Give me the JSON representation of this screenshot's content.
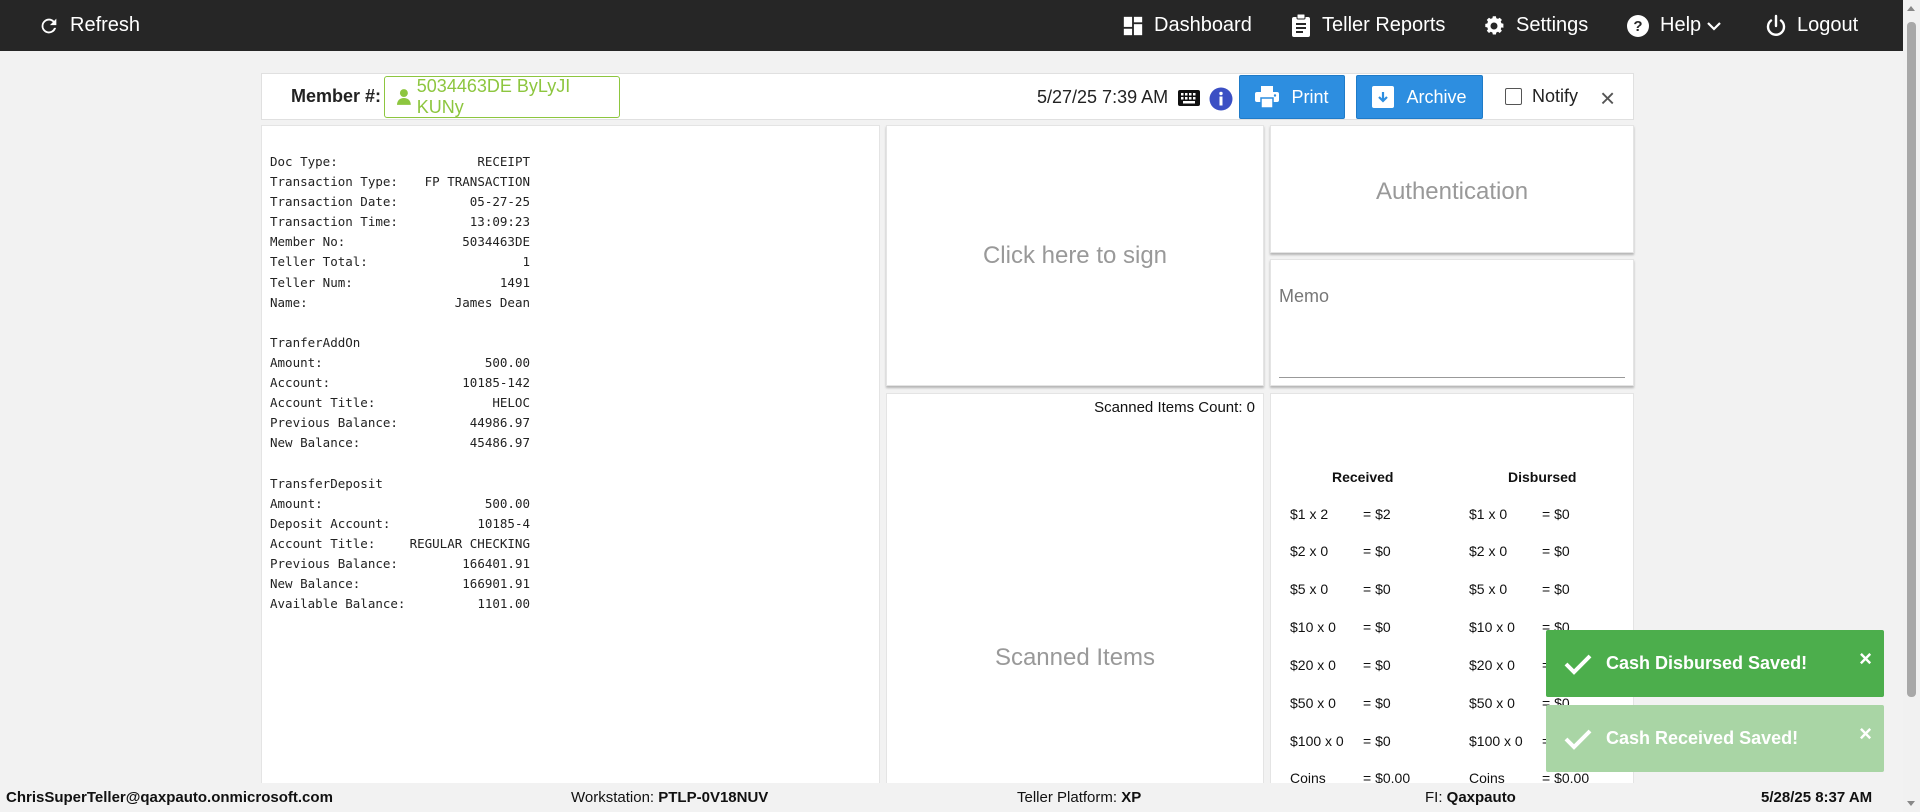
{
  "nav": {
    "refresh": "Refresh",
    "dashboard": "Dashboard",
    "teller_reports": "Teller Reports",
    "settings": "Settings",
    "help": "Help",
    "logout": "Logout"
  },
  "member_bar": {
    "label": "Member #:",
    "member_value": "5034463DE ByLyJI KUNy",
    "datetime": "5/27/25 7:39 AM",
    "print_label": "Print",
    "archive_label": "Archive",
    "notify_label": "Notify",
    "close_symbol": "×"
  },
  "receipt": {
    "lines": [
      {
        "k": "Doc Type:",
        "v": "RECEIPT"
      },
      {
        "k": "Transaction Type:",
        "v": "FP TRANSACTION"
      },
      {
        "k": "Transaction Date:",
        "v": "05-27-25"
      },
      {
        "k": "Transaction Time:",
        "v": "13:09:23"
      },
      {
        "k": "Member No:",
        "v": "5034463DE"
      },
      {
        "k": "Teller Total:",
        "v": "1"
      },
      {
        "k": "Teller Num:",
        "v": "1491"
      },
      {
        "k": "Name:",
        "v": "James Dean"
      },
      {
        "k": "",
        "v": ""
      },
      {
        "k": "TranferAddOn",
        "v": ""
      },
      {
        "k": "Amount:",
        "v": "500.00"
      },
      {
        "k": "Account:",
        "v": "10185-142"
      },
      {
        "k": "Account Title:",
        "v": "HELOC"
      },
      {
        "k": "Previous Balance:",
        "v": "44986.97"
      },
      {
        "k": "New Balance:",
        "v": "45486.97"
      },
      {
        "k": "",
        "v": ""
      },
      {
        "k": "TransferDeposit",
        "v": ""
      },
      {
        "k": "Amount:",
        "v": "500.00"
      },
      {
        "k": "Deposit Account:",
        "v": "10185-4"
      },
      {
        "k": "Account Title:",
        "v": "REGULAR CHECKING"
      },
      {
        "k": "Previous Balance:",
        "v": "166401.91"
      },
      {
        "k": "New Balance:",
        "v": "166901.91"
      },
      {
        "k": "Available Balance:",
        "v": "1101.00"
      }
    ]
  },
  "sign": {
    "placeholder": "Click here to sign"
  },
  "auth": {
    "label": "Authentication"
  },
  "memo": {
    "label": "Memo"
  },
  "scanned": {
    "count_label": "Scanned Items Count: 0",
    "placeholder": "Scanned Items"
  },
  "cash": {
    "received_header": "Received",
    "disbursed_header": "Disbursed",
    "received": [
      {
        "d": "$1 x 2",
        "t": "= $2"
      },
      {
        "d": "$2 x 0",
        "t": "= $0"
      },
      {
        "d": "$5 x 0",
        "t": "= $0"
      },
      {
        "d": "$10 x 0",
        "t": "= $0"
      },
      {
        "d": "$20 x 0",
        "t": "= $0"
      },
      {
        "d": "$50 x 0",
        "t": "= $0"
      },
      {
        "d": "$100 x 0",
        "t": "= $0"
      },
      {
        "d": "Coins",
        "t": "= $0.00"
      }
    ],
    "disbursed": [
      {
        "d": "$1 x 0",
        "t": "= $0"
      },
      {
        "d": "$2 x 0",
        "t": "= $0"
      },
      {
        "d": "$5 x 0",
        "t": "= $0"
      },
      {
        "d": "$10 x 0",
        "t": "= $0"
      },
      {
        "d": "$20 x 0",
        "t": "= $0"
      },
      {
        "d": "$50 x 0",
        "t": "= $0"
      },
      {
        "d": "$100 x 0",
        "t": "= $0"
      },
      {
        "d": "Coins",
        "t": "= $0.00"
      }
    ]
  },
  "toasts": {
    "disbursed": "Cash Disbursed Saved!",
    "received": "Cash Received Saved!",
    "close_symbol": "×"
  },
  "footer": {
    "user": "ChrisSuperTeller@qaxpauto.onmicrosoft.com",
    "workstation_label": "Workstation:",
    "workstation_value": "PTLP-0V18NUV",
    "platform_label": "Teller Platform:",
    "platform_value": "XP",
    "fi_label": "FI:",
    "fi_value": "Qaxpauto",
    "datetime": "5/28/25 8:37 AM"
  },
  "colors": {
    "nav_bg": "#262626",
    "accent_blue": "#2d8ee0",
    "member_green": "#8dc63f",
    "toast_green": "#4cae4c",
    "toast_green_faded": "#a9d5a5",
    "info_blue": "#3b4fc4"
  }
}
